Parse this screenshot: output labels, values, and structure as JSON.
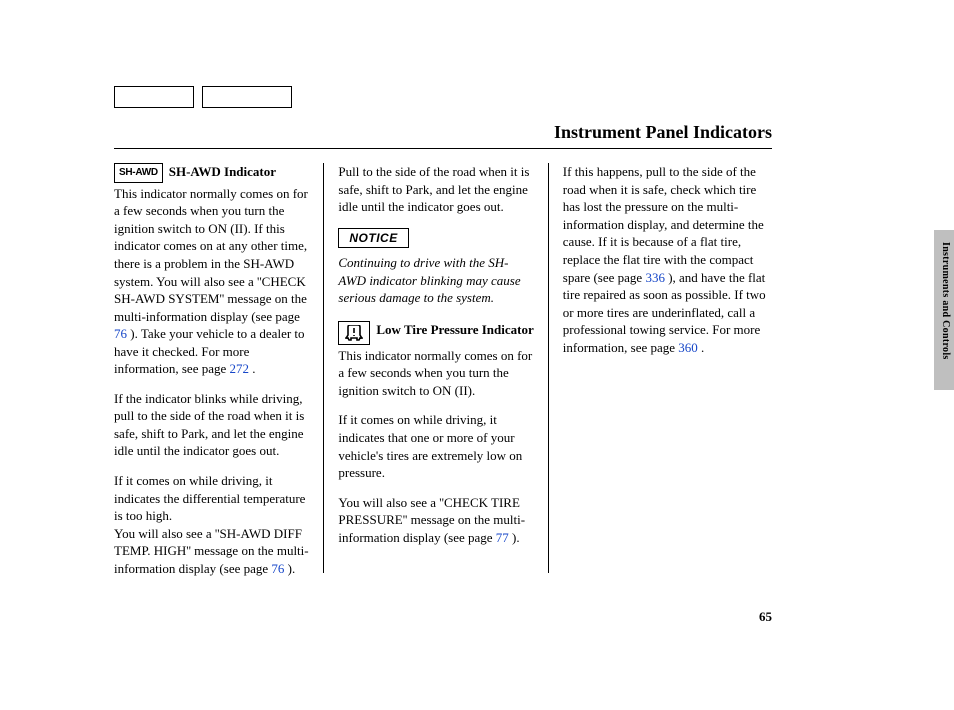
{
  "title": "Instrument Panel Indicators",
  "page_number": "65",
  "side_label": "Instruments and Controls",
  "notice_label": "NOTICE",
  "icons": {
    "shawd": "SH-AWD"
  },
  "col1": {
    "h1": "SH-AWD Indicator",
    "p1a": "This indicator normally comes on for a few seconds when you turn the ignition switch to ON (II). If this indicator comes on at any other time, there is a problem in the SH-AWD system. You will also see a ''CHECK SH-AWD SYSTEM'' message on the multi-information display (see page ",
    "l1": "76",
    "p1b": " ). Take your vehicle to a dealer to have it checked. For more information, see page ",
    "l2": "272",
    "p1c": " .",
    "p2": "If the indicator blinks while driving, pull to the side of the road when it is safe, shift to Park, and let the engine idle until the indicator goes out.",
    "p3": "If it comes on while driving, it indicates the differential temperature is too high.",
    "p4a": "You will also see a ''SH-AWD DIFF TEMP. HIGH'' message on the multi-information display (see page ",
    "l3": "76",
    "p4b": " )."
  },
  "col2": {
    "p1": "Pull to the side of the road when it is safe, shift to Park, and let the engine idle until the indicator goes out.",
    "notice": "Continuing to drive with the SH-AWD indicator blinking may cause serious damage to the system.",
    "h2": "Low Tire Pressure Indicator",
    "p2": "This indicator normally comes on for a few seconds when you turn the ignition switch to ON (II).",
    "p3": "If it comes on while driving, it indicates that one or more of your vehicle's tires are extremely low on pressure.",
    "p4a": "You will also see a ''CHECK TIRE PRESSURE'' message on the multi-information display (see page ",
    "l4": "77",
    "p4b": " )."
  },
  "col3": {
    "p1a": "If this happens, pull to the side of the road when it is safe, check which tire has lost the pressure on the multi-information display, and determine the cause. If it is because of a flat tire, replace the flat tire with the compact spare (see page ",
    "l5": "336",
    "p1b": " ), and have the flat tire repaired as soon as possible. If two or more tires are underinflated, call a professional towing service. For more information, see page ",
    "l6": "360",
    "p1c": " ."
  }
}
